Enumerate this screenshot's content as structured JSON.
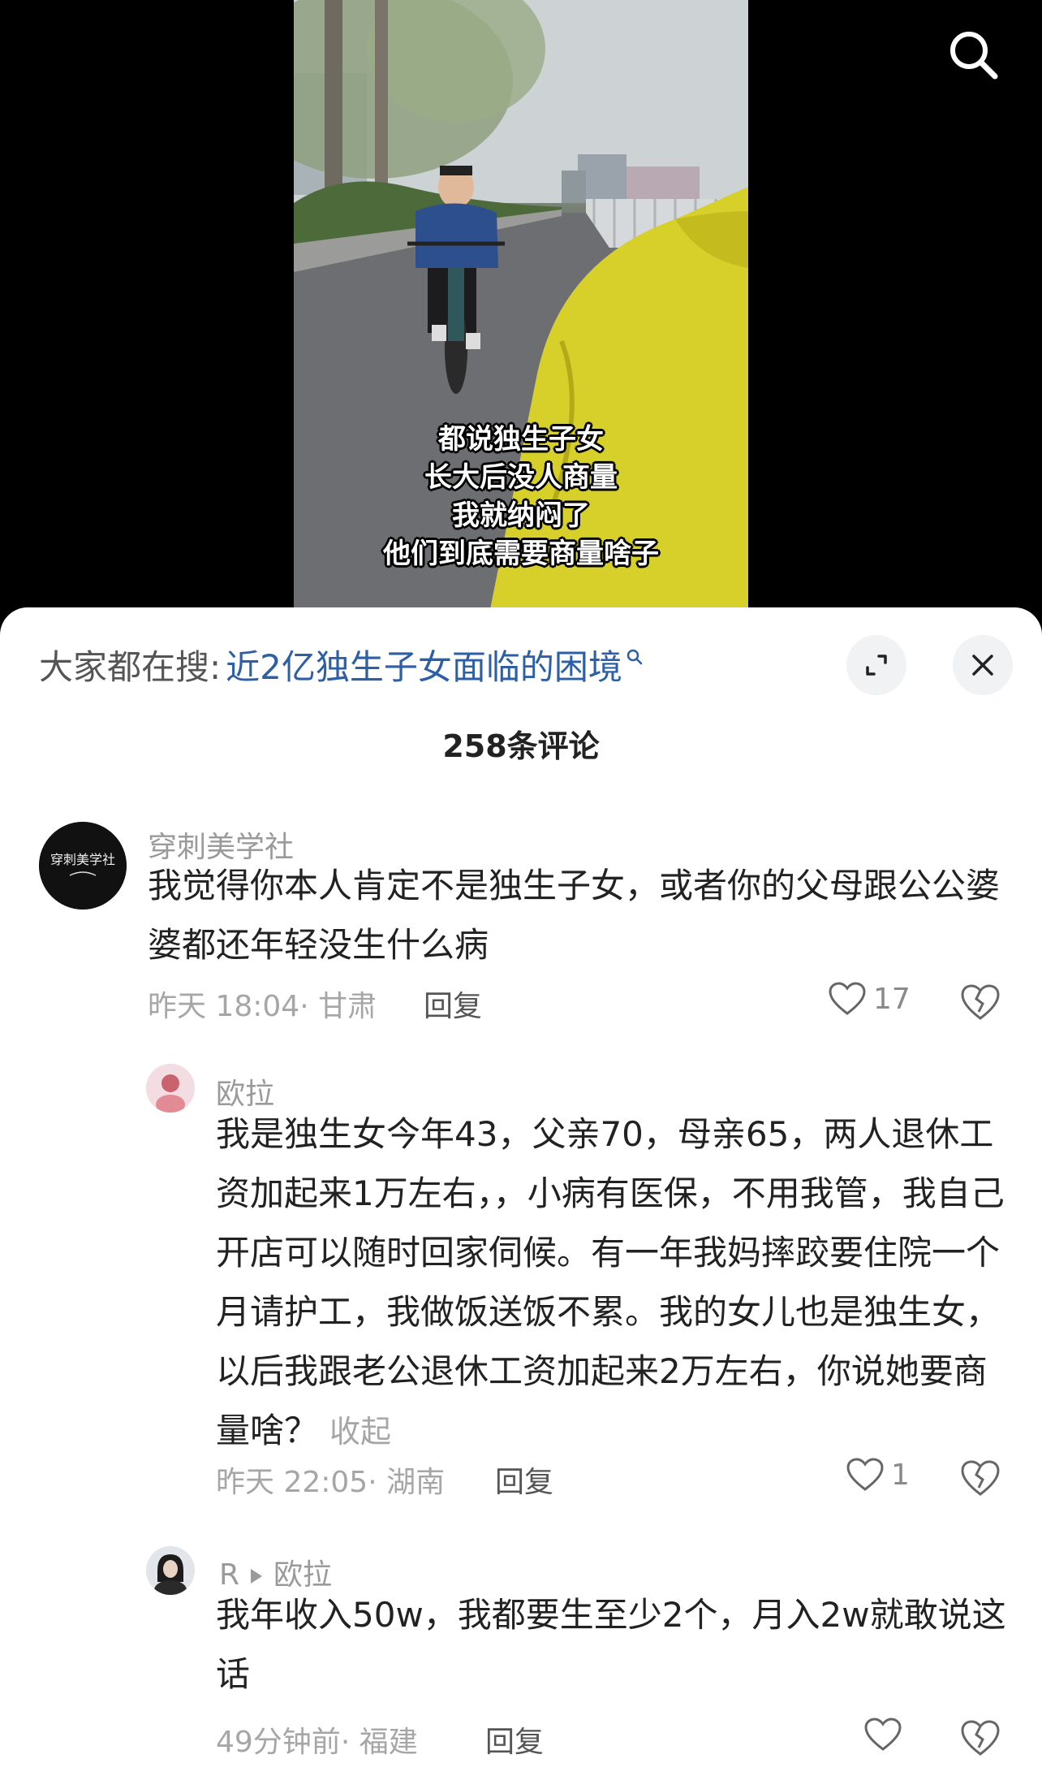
{
  "video": {
    "subtitles": [
      "都说独生子女",
      "长大后没人商量",
      "我就纳闷了",
      "他们到底需要商量啥子"
    ],
    "search_icon": "search-icon"
  },
  "sheet": {
    "search_prefix": "大家都在搜:",
    "search_term": "近2亿独生子女面临的困境",
    "comment_count_label": "258条评论"
  },
  "comments": [
    {
      "username": "穿刺美学社",
      "avatar_text": "穿刺美学社",
      "text": "我觉得你本人肯定不是独生子女，或者你的父母跟公公婆婆都还年轻没生什么病",
      "time": "昨天 18:04",
      "location": "· 甘肃",
      "reply_label": "回复",
      "likes": "17"
    },
    {
      "username": "欧拉",
      "text": "我是独生女今年43，父亲70，母亲65，两人退休工资加起来1万左右，，小病有医保，不用我管，我自己开店可以随时回家伺候。有一年我妈摔跤要住院一个月请护工，我做饭送饭不累。我的女儿也是独生女，以后我跟老公退休工资加起来2万左右，你说她要商量啥？",
      "collapse_label": "收起",
      "time": "昨天 22:05",
      "location": "· 湖南",
      "reply_label": "回复",
      "likes": "1"
    },
    {
      "username": "R",
      "reply_to": "欧拉",
      "text": "我年收入50w，我都要生至少2个，月入2w就敢说这话",
      "time": "49分钟前",
      "location": "· 福建",
      "reply_label": "回复",
      "likes": ""
    }
  ],
  "colors": {
    "link_blue": "#2d5fa6",
    "video_jacket_yellow": "#d8d02a",
    "sheet_background": "#ffffff"
  }
}
